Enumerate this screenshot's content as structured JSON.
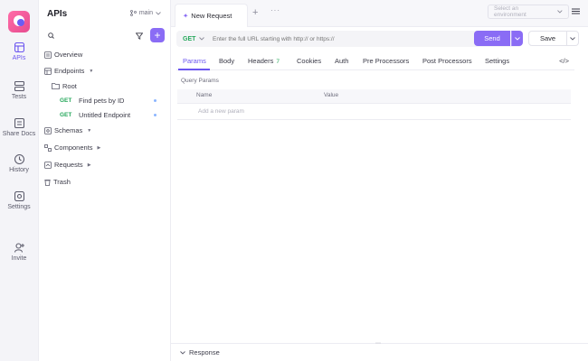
{
  "rail": {
    "items": [
      {
        "label": "APIs",
        "icon": "apis-icon",
        "active": true
      },
      {
        "label": "Tests",
        "icon": "tests-icon",
        "active": false
      },
      {
        "label": "Share Docs",
        "icon": "share-docs-icon",
        "active": false
      },
      {
        "label": "History",
        "icon": "history-icon",
        "active": false
      },
      {
        "label": "Settings",
        "icon": "settings-icon",
        "active": false
      },
      {
        "label": "Invite",
        "icon": "invite-icon",
        "active": false
      }
    ],
    "accent": "#6b55f0"
  },
  "sidebar": {
    "title": "APIs",
    "branch": "main",
    "search_placeholder": "",
    "tree": {
      "overview": "Overview",
      "endpoints": "Endpoints",
      "root_folder": "Root",
      "endpoint_items": [
        {
          "method": "GET",
          "label": "Find pets by ID"
        },
        {
          "method": "GET",
          "label": "Untitled Endpoint"
        }
      ],
      "schemas": "Schemas",
      "components": "Components",
      "requests": "Requests",
      "trash": "Trash"
    }
  },
  "tabs": {
    "active_tab": "New Request",
    "more": "···",
    "env_placeholder": "Select an environment"
  },
  "request": {
    "method": "GET",
    "url_placeholder": "Enter the full URL starting with http:// or https://",
    "send_label": "Send",
    "save_label": "Save",
    "tabs": [
      {
        "label": "Params",
        "active": true
      },
      {
        "label": "Body"
      },
      {
        "label": "Headers",
        "badge": "7"
      },
      {
        "label": "Cookies"
      },
      {
        "label": "Auth"
      },
      {
        "label": "Pre Processors"
      },
      {
        "label": "Post Processors"
      },
      {
        "label": "Settings"
      }
    ],
    "code_label": "</>",
    "query_params_label": "Query Params",
    "columns": [
      "Name",
      "Value"
    ],
    "add_param_placeholder": "Add a new param"
  },
  "response": {
    "label": "Response"
  },
  "colors": {
    "primary": "#8a6cf5",
    "get": "#27a85c"
  }
}
